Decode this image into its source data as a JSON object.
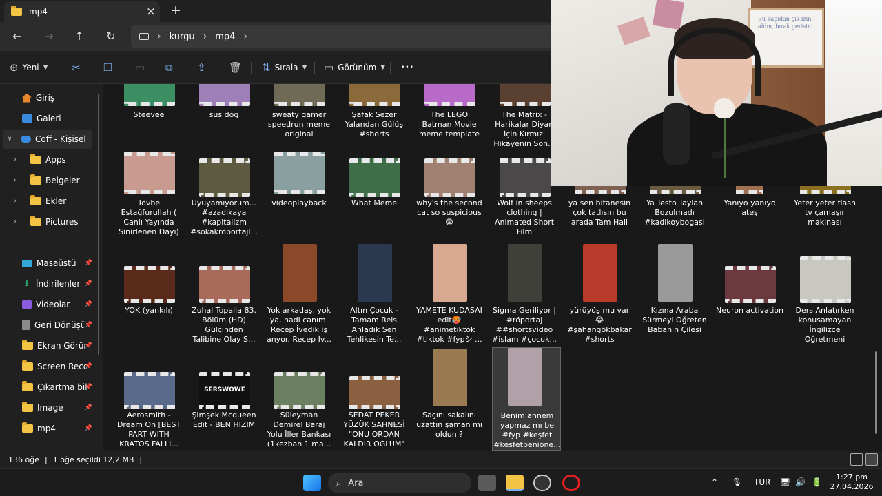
{
  "window": {
    "tab_title": "mp4",
    "tab_close_icon": "×",
    "new_tab_icon": "+"
  },
  "nav": {
    "back_icon": "←",
    "forward_icon": "→",
    "up_icon": "↑",
    "refresh_icon": "↻",
    "breadcrumb": [
      "kurgu",
      "mp4"
    ],
    "sep": "›"
  },
  "toolbar": {
    "new_label": "Yeni",
    "sort_label": "Sırala",
    "view_label": "Görünüm",
    "more_icon": "•••"
  },
  "sidebar": {
    "items": [
      {
        "label": "Giriş",
        "icon": "home-icon"
      },
      {
        "label": "Galeri",
        "icon": "gallery-icon"
      },
      {
        "label": "Coff - Kişisel",
        "icon": "cloud-icon"
      },
      {
        "label": "Apps",
        "icon": "folder-icon"
      },
      {
        "label": "Belgeler",
        "icon": "folder-icon"
      },
      {
        "label": "Ekler",
        "icon": "folder-icon"
      },
      {
        "label": "Pictures",
        "icon": "folder-icon"
      }
    ],
    "pinned": [
      {
        "label": "Masaüstü",
        "icon": "desktop-icon"
      },
      {
        "label": "İndirilenler",
        "icon": "download-icon"
      },
      {
        "label": "Videolar",
        "icon": "video-icon"
      },
      {
        "label": "Geri Dönüşüm",
        "icon": "recycle-bin-icon"
      },
      {
        "label": "Ekran Görüntü",
        "icon": "folder-icon"
      },
      {
        "label": "Screen Record",
        "icon": "folder-icon"
      },
      {
        "label": "Çıkartma bilm",
        "icon": "folder-icon"
      },
      {
        "label": "Image",
        "icon": "folder-icon"
      },
      {
        "label": "mp4",
        "icon": "folder-icon"
      }
    ]
  },
  "files": {
    "row1": [
      {
        "name": "Steevee",
        "color": "#3b8f62"
      },
      {
        "name": "sus dog",
        "color": "#9f7fb8"
      },
      {
        "name": "sweaty gamer speedrun meme original",
        "color": "#6e6a55"
      },
      {
        "name": "Şafak Sezer Yalandan Gülüş #shorts",
        "color": "#8a6a3a"
      },
      {
        "name": "The LEGO Batman Movie meme template",
        "color": "#b86ac8"
      },
      {
        "name": "The Matrix - Harikalar Diyarı İçin Kırmızı Hikayenin Son...",
        "color": "#5a4030"
      }
    ],
    "row2": [
      {
        "name": "Tövbe Estağfurullah ( Canlı Yayında Sinirlenen Dayı)",
        "color": "#c89a90"
      },
      {
        "name": "Uyuyamıyorum... #azadikaya #kapitalizm #sokakröportajl...",
        "color": "#5d5a40"
      },
      {
        "name": "videoplayback",
        "color": "#8aa0a0"
      },
      {
        "name": "What Meme",
        "color": "#3e6e48"
      },
      {
        "name": "why's the second cat so suspicious 😨",
        "color": "#a08070"
      },
      {
        "name": "Wolf in sheeps clothing | Animated Short Film",
        "color": "#4a4848"
      },
      {
        "name": "ya sen bitanesin çok tatlısın bu arada Tam Hali",
        "color": "#806050"
      },
      {
        "name": "Ya Testo Taylan Bozulmadı #kadikoybogasi",
        "color": "#6a5a40"
      },
      {
        "name": "Yanıyo yanıyo ateş",
        "color": "#a07050"
      },
      {
        "name": "Yeter yeter flash tv çamaşır makinası",
        "color": "#8a7020"
      }
    ],
    "row3": [
      {
        "name": "YOK (yankılı)",
        "color": "#5a2a1a"
      },
      {
        "name": "Zuhal Topallа 83. Bölüm (HD) Gülçinden Talibine Olay S...",
        "color": "#a86a5a"
      },
      {
        "name": "Yok arkadaş, yok ya, hadi canım. Recep İvedik iş anyor. Recep İv...",
        "color": "#8a4a2a"
      },
      {
        "name": "Altın Çocuk - Tamam Reis Anladık Sen Tehlikesin Te...",
        "color": "#2a3850"
      },
      {
        "name": "YAMETE KUDASAI edit🥵 #animetiktok #tiktok #fypシ ...",
        "color": "#d8a890"
      },
      {
        "name": "Sigma Geriliyor | #röportaj ##shortsvideo #islam #çocuk...",
        "color": "#40403a"
      },
      {
        "name": "yürüyüş mu var 😂 #şahangökbakar #shorts",
        "color": "#b83a2a"
      },
      {
        "name": "Kızına Araba Sürmeyi Öğreten Babanın Çilesi",
        "color": "#9a9a9a"
      },
      {
        "name": "Neuron activation",
        "color": "#6a3a40"
      },
      {
        "name": "Ders Anlatırken konusamayan İngilizce Öğretmeni",
        "color": "#c8c8c0"
      }
    ],
    "row4": [
      {
        "name": "Aerosmith - Dream On [BEST PART WITH KRATOS FALLI...",
        "color": "#5a6a8a"
      },
      {
        "name": "Şimşek Mcqueen Edit - BEN HIZIM",
        "color": "#111111",
        "logo": "SERSWOWE"
      },
      {
        "name": "Süleyman Demirel Baraj Yolu İller Bankası (1kezban 1 ma...",
        "color": "#6a8060"
      },
      {
        "name": "SEDAT PEKER YÜZÜK SAHNESİ \"ONU ORDAN KALDIR OĞLUM\"",
        "color": "#8a6040"
      },
      {
        "name": "Saçını sakalını uzattın şaman mı oldun ?",
        "color": "#9a7a50"
      },
      {
        "name": "Benim annem yapmaz mı be #fyp #keşfet #keşfetbeniöne...",
        "color": "#b0a0a8"
      }
    ]
  },
  "status": {
    "count": "136 öğe",
    "selection": "1 öğe seçildi  12,2 MB"
  },
  "webcam": {
    "note": "Bu kapıdan çık izin aldın, bırak gerisini"
  },
  "taskbar": {
    "search_placeholder": "Ara",
    "lang": "TUR",
    "time": "1:27 pm",
    "date": "27.04.2026"
  },
  "colors": {
    "accent": "#7fb2f5",
    "folder": "#f3c443",
    "background": "#191919"
  }
}
